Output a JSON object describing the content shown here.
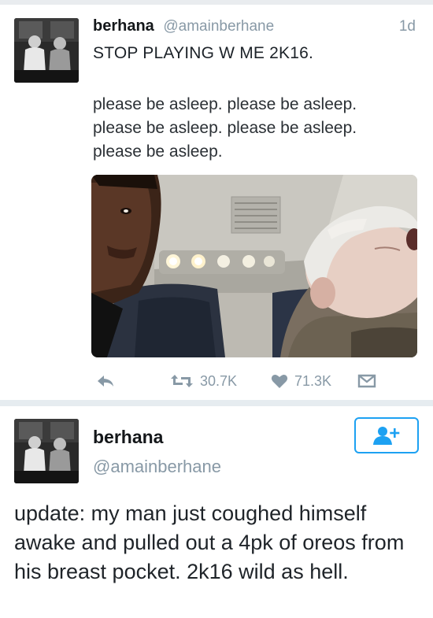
{
  "tweet1": {
    "name": "berhana",
    "handle": "@amainberhane",
    "time": "1d",
    "line1": "STOP PLAYING W ME 2K16.",
    "line2": "please be asleep. please be asleep. please be asleep. please be asleep. please be asleep.",
    "retweets": "30.7K",
    "likes": "71.3K",
    "icons": [
      "reply-icon",
      "retweet-icon",
      "heart-icon",
      "direct-message-icon"
    ],
    "colors": {
      "icon_gray": "#8899a6",
      "handle_gray": "#8899a6"
    }
  },
  "tweet2": {
    "name": "berhana",
    "handle": "@amainberhane",
    "body": "update: my man just coughed himself awake and pulled out a 4pk of oreos from his breast pocket. 2k16 wild as hell.",
    "follow_icon": "follow-user-plus-icon",
    "colors": {
      "accent": "#1da1f2"
    }
  }
}
